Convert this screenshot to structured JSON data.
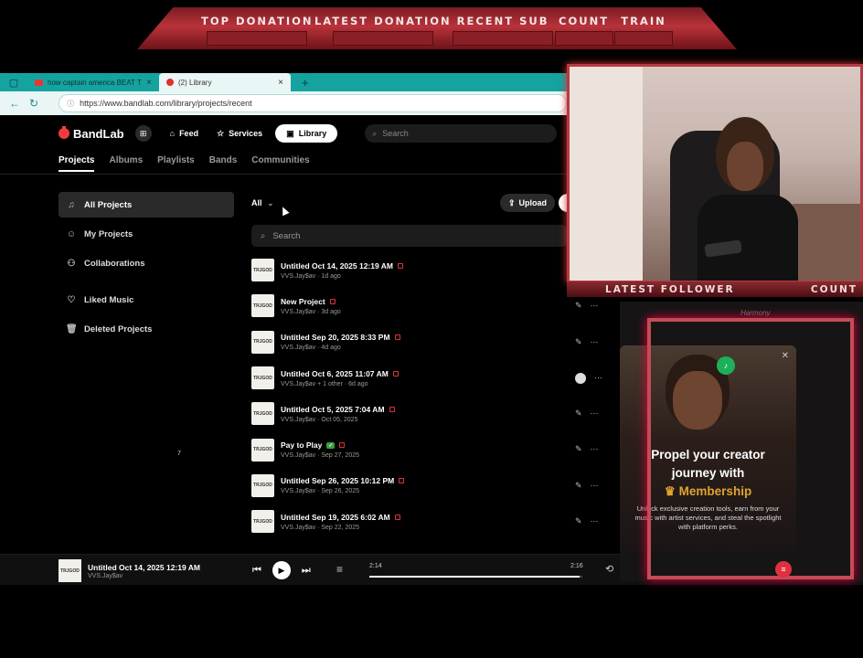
{
  "overlay": {
    "top_labels": [
      "TOP DONATION",
      "LATEST DONATION",
      "RECENT SUB",
      "COUNT",
      "TRAIN"
    ],
    "follower_label": "LATEST FOLLOWER",
    "follower_count_label": "COUNT"
  },
  "browser": {
    "tabs": [
      {
        "title": "how captain america BEAT THE SI",
        "icon": "youtube-icon"
      },
      {
        "title": "(2) Library",
        "icon": "bandlab-icon"
      }
    ],
    "url": "https://www.bandlab.com/library/projects/recent"
  },
  "app": {
    "brand": "BandLab",
    "nav": {
      "feed": "Feed",
      "services": "Services",
      "library": "Library",
      "search_placeholder": "Search"
    },
    "subnav": [
      "Projects",
      "Albums",
      "Playlists",
      "Bands",
      "Communities"
    ],
    "sidebar": [
      {
        "label": "All Projects",
        "icon": "music-note-icon"
      },
      {
        "label": "My Projects",
        "icon": "user-icon"
      },
      {
        "label": "Collaborations",
        "icon": "users-icon"
      },
      {
        "label": "Liked Music",
        "icon": "heart-icon"
      },
      {
        "label": "Deleted Projects",
        "icon": "trash-icon"
      }
    ],
    "stray_text": "7",
    "filter": "All",
    "upload": "Upload",
    "project_search": "Search",
    "thumb_text": "TRJGOD",
    "projects": [
      {
        "title": "Untitled Oct 14, 2025 12:19 AM",
        "sub": "VVS.Jay$av",
        "time": "1d ago"
      },
      {
        "title": "New Project",
        "sub": "VVS.Jay$av",
        "time": "3d ago"
      },
      {
        "title": "Untitled Sep 20, 2025 8:33 PM",
        "sub": "VVS.Jay$av",
        "time": "4d ago"
      },
      {
        "title": "Untitled Oct 6, 2025 11:07 AM",
        "sub": "VVS.Jay$av + 1 other",
        "time": "6d ago"
      },
      {
        "title": "Untitled Oct 5, 2025 7:04 AM",
        "sub": "VVS.Jay$av",
        "time": "Oct 05, 2025"
      },
      {
        "title": "Pay to Play",
        "sub": "VVS.Jay$av",
        "time": "Sep 27, 2025"
      },
      {
        "title": "Untitled Sep 26, 2025 10:12 PM",
        "sub": "VVS.Jay$av",
        "time": "Sep 26, 2025"
      },
      {
        "title": "Untitled Sep 19, 2025 6:02 AM",
        "sub": "VVS.Jay$av",
        "time": "Sep 22, 2025"
      }
    ]
  },
  "player": {
    "title": "Untitled Oct 14, 2025 12:19 AM",
    "artist": "VVS.Jay$av",
    "elapsed": "2:14",
    "total": "2:16",
    "progress": 0.985
  },
  "promo": {
    "line1": "Propel your creator",
    "line2": "journey with",
    "line3": "Membership",
    "body": "Unlock exclusive creation tools, earn from your music with artist services, and steal the spotlight with platform perks.",
    "brand_hint": "Harmony"
  },
  "colors": {
    "accent": "#f23b3b",
    "overlay_red": "#b83a42",
    "tab_teal": "#15a3a0"
  }
}
